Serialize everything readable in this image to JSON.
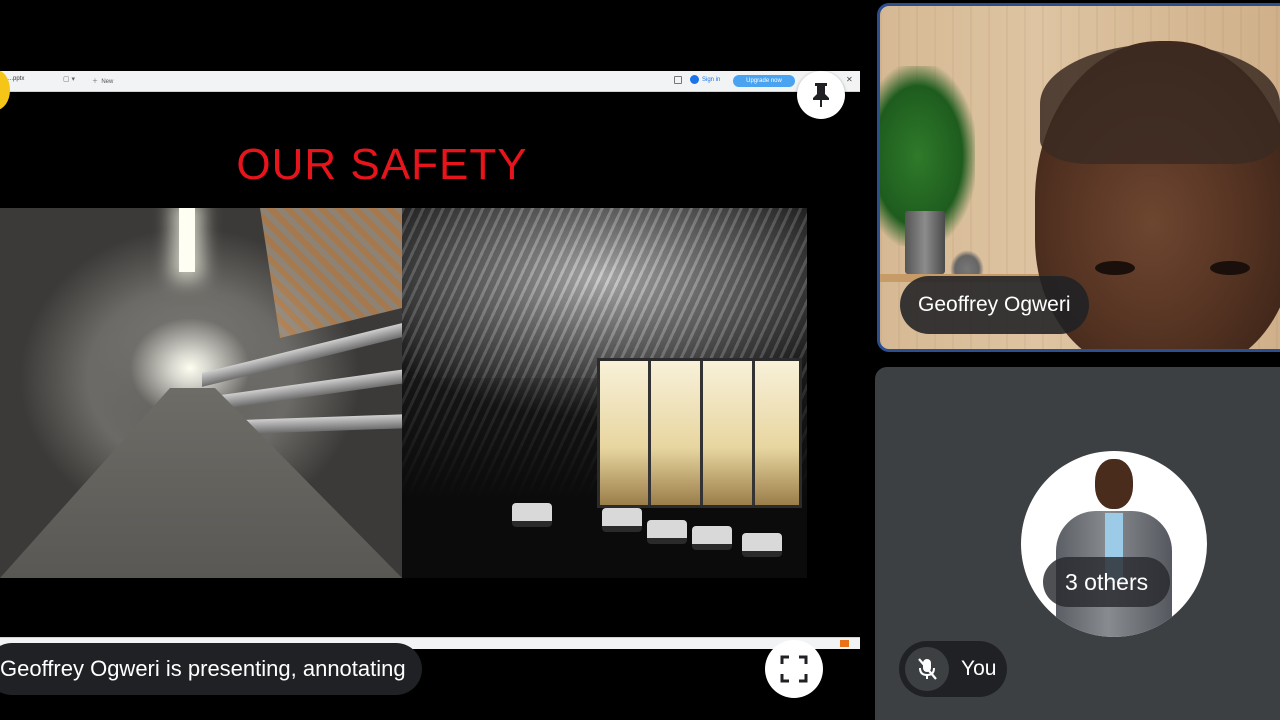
{
  "browser": {
    "tab_label": "...pptx",
    "new_tab_label": "New",
    "sign_in_label": "Sign in",
    "upgrade_label": "Upgrade now"
  },
  "slide": {
    "title": "OUR SAFETY",
    "title_color": "#e8141b"
  },
  "presentation": {
    "status_text": "Geoffrey Ogweri is presenting, annotating",
    "pin_icon": "pin-icon",
    "fullscreen_icon": "fullscreen-icon"
  },
  "participants": {
    "active_speaker_name": "Geoffrey Ogweri",
    "active_border_color": "#2b4f8f",
    "others_label": "3 others",
    "self_label": "You",
    "self_mic_icon": "mic-off-icon"
  }
}
